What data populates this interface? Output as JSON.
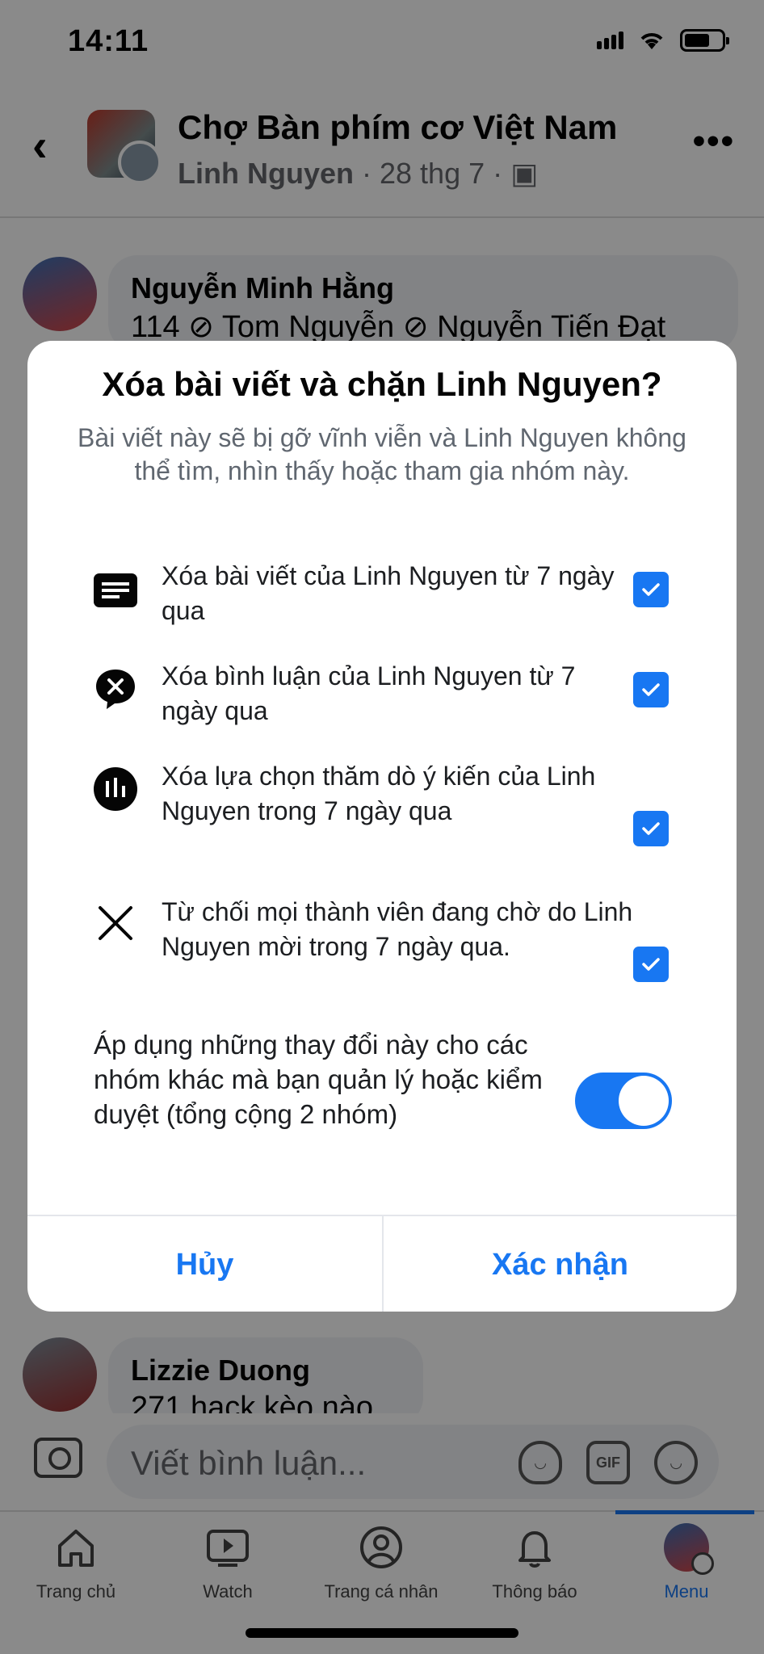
{
  "status_bar": {
    "time": "14:11"
  },
  "header": {
    "group_name": "Chợ Bàn phím cơ Việt Nam",
    "author": "Linh Nguyen",
    "date": "· 28 thg 7 ·"
  },
  "comments": [
    {
      "name": "Nguyễn Minh Hằng",
      "text": "114 ⊘ Tom Nguyễn ⊘ Nguyễn Tiến Đạt"
    },
    {
      "name": "Lizzie Duong",
      "text": "271 hack kèo nào"
    }
  ],
  "compose": {
    "placeholder": "Viết bình luận...",
    "gif_label": "GIF"
  },
  "tabs": [
    {
      "label": "Trang chủ"
    },
    {
      "label": "Watch"
    },
    {
      "label": "Trang cá nhân"
    },
    {
      "label": "Thông báo"
    },
    {
      "label": "Menu"
    }
  ],
  "dialog": {
    "title": "Xóa bài viết và chặn Linh Nguyen?",
    "description": "Bài viết này sẽ bị gỡ vĩnh viễn và Linh Nguyen không thể tìm, nhìn thấy hoặc tham gia nhóm này.",
    "options": [
      {
        "label": "Xóa bài viết của Linh Nguyen từ 7 ngày qua",
        "icon": "post-icon",
        "checked": true
      },
      {
        "label": "Xóa bình luận của Linh Nguyen từ 7 ngày qua",
        "icon": "comment-delete-icon",
        "checked": true
      },
      {
        "label": "Xóa lựa chọn thăm dò ý kiến của Linh Nguyen trong 7 ngày qua",
        "icon": "poll-icon",
        "checked": true
      },
      {
        "label": "Từ chối mọi thành viên đang chờ do Linh Nguyen mời  trong 7 ngày qua.",
        "icon": "x-icon",
        "checked": true
      }
    ],
    "apply_label": "Áp dụng những thay đổi này cho các nhóm khác mà bạn quản lý hoặc kiểm duyệt (tổng cộng 2 nhóm)",
    "apply_on": true,
    "cancel_label": "Hủy",
    "confirm_label": "Xác nhận"
  },
  "colors": {
    "accent": "#1877f2"
  }
}
